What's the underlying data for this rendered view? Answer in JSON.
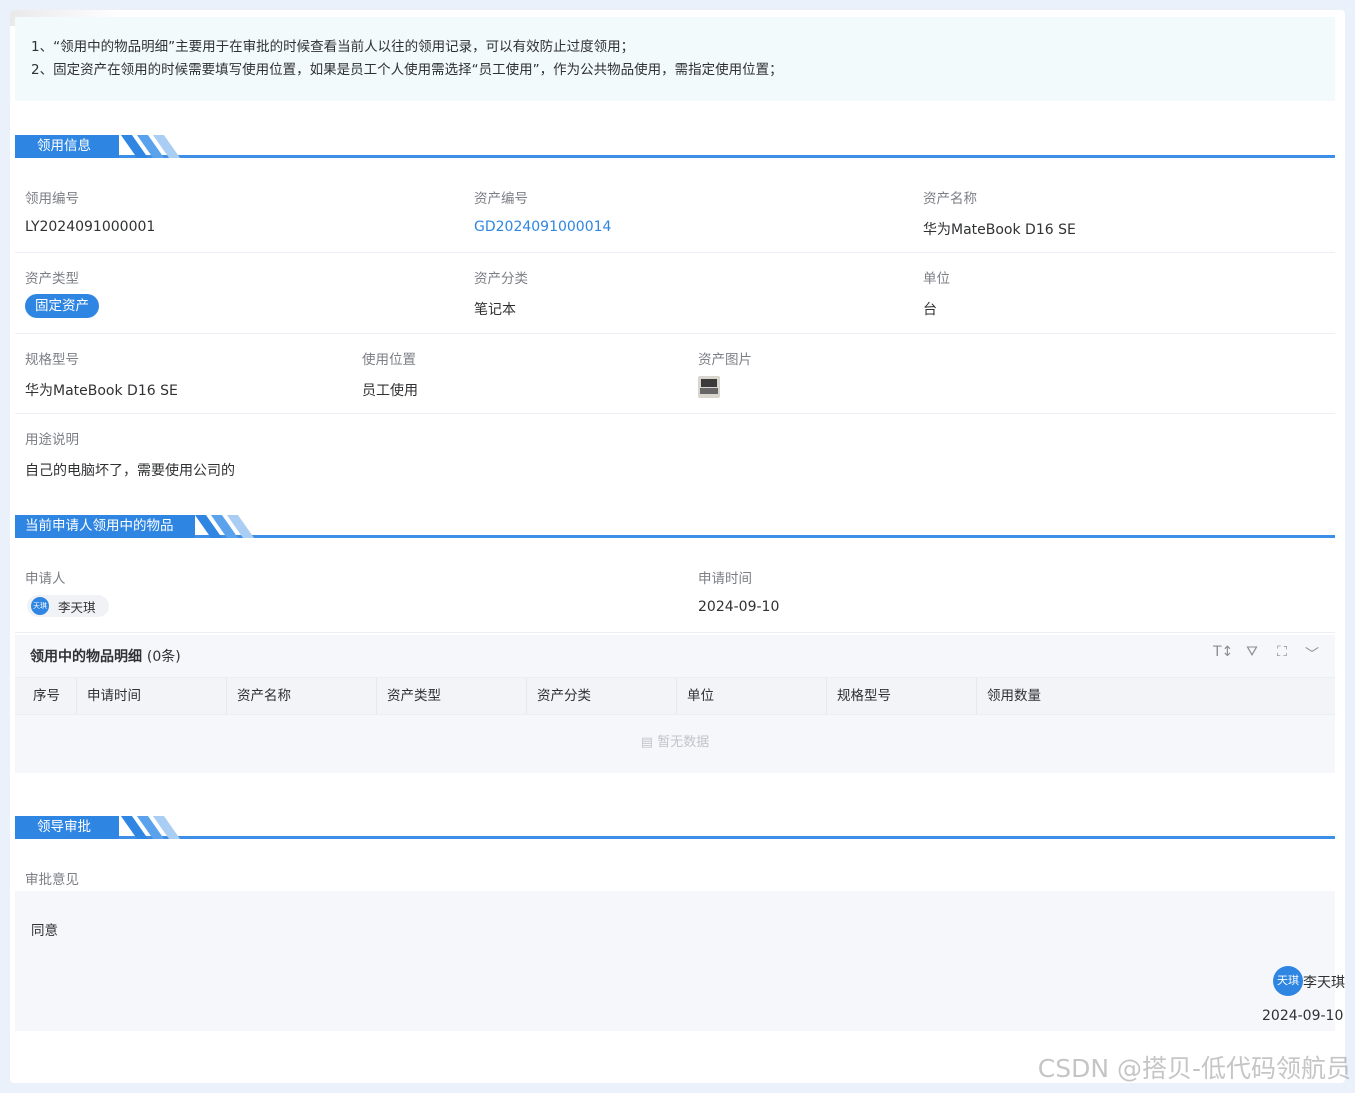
{
  "notice": {
    "line1": "1、“领用中的物品明细”主要用于在审批的时候查看当前人以往的领用记录，可以有效防止过度领用；",
    "line2": "2、固定资产在领用的时候需要填写使用位置，如果是员工个人使用需选择“员工使用”，作为公共物品使用，需指定使用位置；"
  },
  "sections": {
    "info": "领用信息",
    "current_items": "当前申请人领用中的物品",
    "approval": "领导审批"
  },
  "fields": {
    "requisition_no": {
      "label": "领用编号",
      "value": "LY2024091000001"
    },
    "asset_no": {
      "label": "资产编号",
      "value": "GD2024091000014"
    },
    "asset_name": {
      "label": "资产名称",
      "value": "华为MateBook D16 SE"
    },
    "asset_type": {
      "label": "资产类型",
      "value": "固定资产"
    },
    "asset_category": {
      "label": "资产分类",
      "value": "笔记本"
    },
    "unit": {
      "label": "单位",
      "value": "台"
    },
    "spec": {
      "label": "规格型号",
      "value": "华为MateBook D16 SE"
    },
    "location": {
      "label": "使用位置",
      "value": "员工使用"
    },
    "asset_image": {
      "label": "资产图片",
      "icon": "laptop-thumbnail"
    },
    "purpose": {
      "label": "用途说明",
      "value": "自己的电脑坏了，需要使用公司的"
    }
  },
  "applicant": {
    "label": "申请人",
    "avatar_text": "天琪",
    "name": "李天琪",
    "time_label": "申请时间",
    "time": "2024-09-10"
  },
  "items_table": {
    "title": "领用中的物品明细",
    "count": "(0条)",
    "tools": [
      "font-size-icon",
      "filter-icon",
      "fullscreen-icon",
      "chevron-down-icon"
    ],
    "columns": [
      "序号",
      "申请时间",
      "资产名称",
      "资产类型",
      "资产分类",
      "单位",
      "规格型号",
      "领用数量"
    ],
    "rows": [],
    "empty_text": "暂无数据"
  },
  "approval": {
    "label": "审批意见",
    "opinion": "同意",
    "avatar_text": "天琪",
    "approver": "李天琪",
    "date": "2024-09-10"
  },
  "watermark": "CSDN @搭贝-低代码领航员",
  "colors": {
    "accent": "#2f86e2",
    "notice_bg": "#f2fafb",
    "label": "#7c7f85"
  }
}
